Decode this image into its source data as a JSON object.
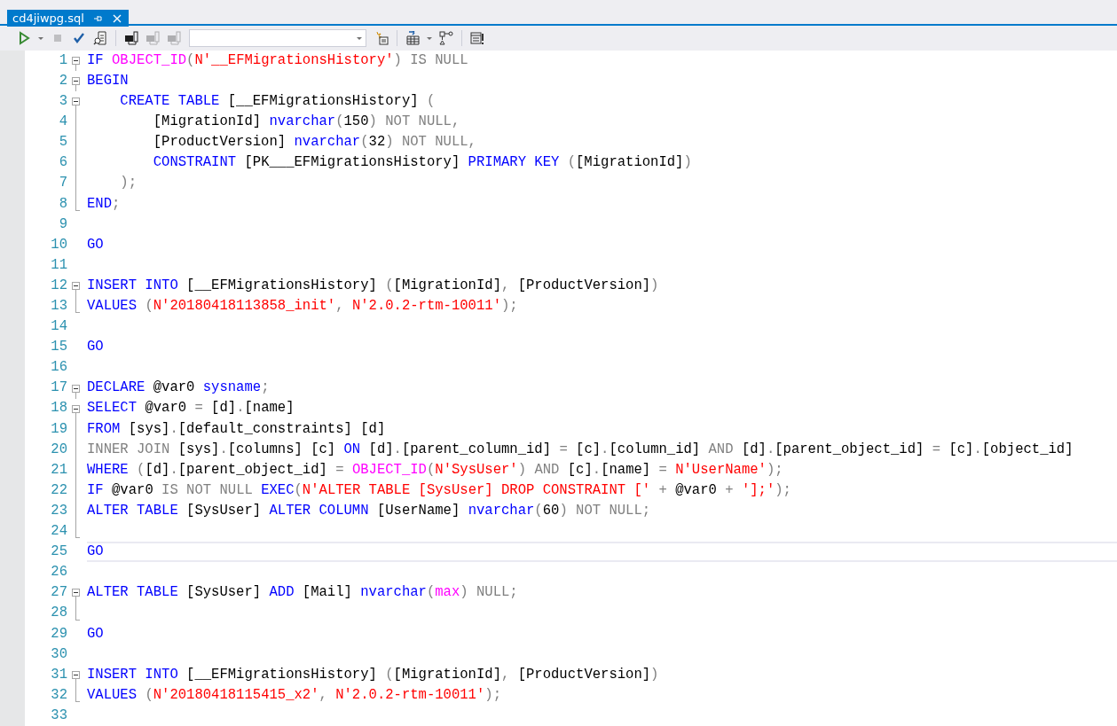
{
  "tab": {
    "title": "cd4jiwpg.sql",
    "selected": true
  },
  "toolbar": [
    {
      "kind": "run",
      "disabled": false
    },
    {
      "kind": "caret",
      "disabled": false
    },
    {
      "kind": "stop",
      "disabled": true
    },
    {
      "kind": "check",
      "disabled": false
    },
    {
      "kind": "doc-search",
      "disabled": false
    },
    {
      "kind": "separator"
    },
    {
      "kind": "connect",
      "disabled": false
    },
    {
      "kind": "connection",
      "disabled": true
    },
    {
      "kind": "connection",
      "disabled": true
    },
    {
      "kind": "combo",
      "disabled": false
    },
    {
      "kind": "new-window",
      "disabled": false
    },
    {
      "kind": "separator"
    },
    {
      "kind": "grid",
      "disabled": false
    },
    {
      "kind": "caret",
      "disabled": false
    },
    {
      "kind": "diagram",
      "disabled": false
    },
    {
      "kind": "separator"
    },
    {
      "kind": "results",
      "disabled": false
    }
  ],
  "editor": {
    "lines": [
      {
        "number": "1",
        "kind": "fold-start",
        "expanded": true,
        "tokens": [
          {
            "kind": "kw",
            "text": "IF "
          },
          {
            "kind": "fn",
            "text": "OBJECT_ID"
          },
          {
            "kind": "op",
            "text": "("
          },
          {
            "kind": "str",
            "text": "N'__EFMigrationsHistory'"
          },
          {
            "kind": "op",
            "text": ") IS NULL"
          }
        ]
      },
      {
        "number": "2",
        "kind": "fold-start",
        "expanded": true,
        "tokens": [
          {
            "kind": "kw",
            "text": "BEGIN"
          }
        ]
      },
      {
        "number": "3",
        "kind": "fold-start",
        "expanded": true,
        "tokens": [
          {
            "kind": "kw",
            "text": "    CREATE TABLE "
          },
          {
            "kind": "id",
            "text": "[__EFMigrationsHistory] "
          },
          {
            "kind": "op",
            "text": "("
          }
        ]
      },
      {
        "number": "4",
        "kind": "fold-body",
        "tokens": [
          {
            "kind": "id",
            "text": "        [MigrationId] "
          },
          {
            "kind": "kw",
            "text": "nvarchar"
          },
          {
            "kind": "op",
            "text": "("
          },
          {
            "kind": "id",
            "text": "150"
          },
          {
            "kind": "op",
            "text": ") NOT NULL,"
          }
        ]
      },
      {
        "number": "5",
        "kind": "fold-body",
        "tokens": [
          {
            "kind": "id",
            "text": "        [ProductVersion] "
          },
          {
            "kind": "kw",
            "text": "nvarchar"
          },
          {
            "kind": "op",
            "text": "("
          },
          {
            "kind": "id",
            "text": "32"
          },
          {
            "kind": "op",
            "text": ") NOT NULL,"
          }
        ]
      },
      {
        "number": "6",
        "kind": "fold-body",
        "tokens": [
          {
            "kind": "kw",
            "text": "        CONSTRAINT "
          },
          {
            "kind": "id",
            "text": "[PK___EFMigrationsHistory] "
          },
          {
            "kind": "kw",
            "text": "PRIMARY KEY "
          },
          {
            "kind": "op",
            "text": "("
          },
          {
            "kind": "id",
            "text": "[MigrationId]"
          },
          {
            "kind": "op",
            "text": ")"
          }
        ]
      },
      {
        "number": "7",
        "kind": "fold-body",
        "tokens": [
          {
            "kind": "op",
            "text": "    );"
          }
        ]
      },
      {
        "number": "8",
        "kind": "fold-end",
        "tokens": [
          {
            "kind": "kw",
            "text": "END"
          },
          {
            "kind": "op",
            "text": ";"
          }
        ]
      },
      {
        "number": "9"
      },
      {
        "number": "10",
        "tokens": [
          {
            "kind": "kw",
            "text": "GO"
          }
        ]
      },
      {
        "number": "11"
      },
      {
        "number": "12",
        "kind": "fold-start",
        "expanded": true,
        "tokens": [
          {
            "kind": "kw",
            "text": "INSERT INTO "
          },
          {
            "kind": "id",
            "text": "[__EFMigrationsHistory] "
          },
          {
            "kind": "op",
            "text": "("
          },
          {
            "kind": "id",
            "text": "[MigrationId]"
          },
          {
            "kind": "op",
            "text": ", "
          },
          {
            "kind": "id",
            "text": "[ProductVersion]"
          },
          {
            "kind": "op",
            "text": ")"
          }
        ]
      },
      {
        "number": "13",
        "kind": "fold-end",
        "tokens": [
          {
            "kind": "kw",
            "text": "VALUES "
          },
          {
            "kind": "op",
            "text": "("
          },
          {
            "kind": "str",
            "text": "N'20180418113858_init'"
          },
          {
            "kind": "op",
            "text": ", "
          },
          {
            "kind": "str",
            "text": "N'2.0.2-rtm-10011'"
          },
          {
            "kind": "op",
            "text": ");"
          }
        ]
      },
      {
        "number": "14"
      },
      {
        "number": "15",
        "tokens": [
          {
            "kind": "kw",
            "text": "GO"
          }
        ]
      },
      {
        "number": "16"
      },
      {
        "number": "17",
        "kind": "fold-start",
        "expanded": true,
        "tokens": [
          {
            "kind": "kw",
            "text": "DECLARE "
          },
          {
            "kind": "id",
            "text": "@var0 "
          },
          {
            "kind": "kw",
            "text": "sysname"
          },
          {
            "kind": "op",
            "text": ";"
          }
        ]
      },
      {
        "number": "18",
        "kind": "fold-start",
        "expanded": true,
        "tokens": [
          {
            "kind": "kw",
            "text": "SELECT "
          },
          {
            "kind": "id",
            "text": "@var0 "
          },
          {
            "kind": "op",
            "text": "= "
          },
          {
            "kind": "id",
            "text": "[d]"
          },
          {
            "kind": "op",
            "text": "."
          },
          {
            "kind": "id",
            "text": "[name]"
          }
        ]
      },
      {
        "number": "19",
        "kind": "fold-body",
        "tokens": [
          {
            "kind": "kw",
            "text": "FROM "
          },
          {
            "kind": "id",
            "text": "[sys]"
          },
          {
            "kind": "op",
            "text": "."
          },
          {
            "kind": "id",
            "text": "[default_constraints] [d]"
          }
        ]
      },
      {
        "number": "20",
        "kind": "fold-body",
        "tokens": [
          {
            "kind": "op",
            "text": "INNER JOIN "
          },
          {
            "kind": "id",
            "text": "[sys]"
          },
          {
            "kind": "op",
            "text": "."
          },
          {
            "kind": "id",
            "text": "[columns] [c] "
          },
          {
            "kind": "kw",
            "text": "ON "
          },
          {
            "kind": "id",
            "text": "[d]"
          },
          {
            "kind": "op",
            "text": "."
          },
          {
            "kind": "id",
            "text": "[parent_column_id] "
          },
          {
            "kind": "op",
            "text": "= "
          },
          {
            "kind": "id",
            "text": "[c]"
          },
          {
            "kind": "op",
            "text": "."
          },
          {
            "kind": "id",
            "text": "[column_id] "
          },
          {
            "kind": "op",
            "text": "AND "
          },
          {
            "kind": "id",
            "text": "[d]"
          },
          {
            "kind": "op",
            "text": "."
          },
          {
            "kind": "id",
            "text": "[parent_object_id] "
          },
          {
            "kind": "op",
            "text": "= "
          },
          {
            "kind": "id",
            "text": "[c]"
          },
          {
            "kind": "op",
            "text": "."
          },
          {
            "kind": "id",
            "text": "[object_id]"
          }
        ]
      },
      {
        "number": "21",
        "kind": "fold-body",
        "tokens": [
          {
            "kind": "kw",
            "text": "WHERE "
          },
          {
            "kind": "op",
            "text": "("
          },
          {
            "kind": "id",
            "text": "[d]"
          },
          {
            "kind": "op",
            "text": "."
          },
          {
            "kind": "id",
            "text": "[parent_object_id] "
          },
          {
            "kind": "op",
            "text": "= "
          },
          {
            "kind": "fn",
            "text": "OBJECT_ID"
          },
          {
            "kind": "op",
            "text": "("
          },
          {
            "kind": "str",
            "text": "N'SysUser'"
          },
          {
            "kind": "op",
            "text": ") AND "
          },
          {
            "kind": "id",
            "text": "[c]"
          },
          {
            "kind": "op",
            "text": "."
          },
          {
            "kind": "id",
            "text": "[name] "
          },
          {
            "kind": "op",
            "text": "= "
          },
          {
            "kind": "str",
            "text": "N'UserName'"
          },
          {
            "kind": "op",
            "text": ");"
          }
        ]
      },
      {
        "number": "22",
        "kind": "fold-body",
        "tokens": [
          {
            "kind": "kw",
            "text": "IF "
          },
          {
            "kind": "id",
            "text": "@var0 "
          },
          {
            "kind": "op",
            "text": "IS NOT NULL "
          },
          {
            "kind": "kw",
            "text": "EXEC"
          },
          {
            "kind": "op",
            "text": "("
          },
          {
            "kind": "str",
            "text": "N'ALTER TABLE [SysUser] DROP CONSTRAINT ['"
          },
          {
            "kind": "op",
            "text": " + "
          },
          {
            "kind": "id",
            "text": "@var0"
          },
          {
            "kind": "op",
            "text": " + "
          },
          {
            "kind": "str",
            "text": "'];'"
          },
          {
            "kind": "op",
            "text": ");"
          }
        ]
      },
      {
        "number": "23",
        "kind": "fold-body",
        "tokens": [
          {
            "kind": "kw",
            "text": "ALTER TABLE "
          },
          {
            "kind": "id",
            "text": "[SysUser] "
          },
          {
            "kind": "kw",
            "text": "ALTER COLUMN "
          },
          {
            "kind": "id",
            "text": "[UserName] "
          },
          {
            "kind": "kw",
            "text": "nvarchar"
          },
          {
            "kind": "op",
            "text": "("
          },
          {
            "kind": "id",
            "text": "60"
          },
          {
            "kind": "op",
            "text": ") NOT NULL;"
          }
        ]
      },
      {
        "number": "24",
        "kind": "fold-end"
      },
      {
        "number": "25",
        "current": true,
        "tokens": [
          {
            "kind": "kw",
            "text": "GO"
          }
        ]
      },
      {
        "number": "26"
      },
      {
        "number": "27",
        "kind": "fold-start",
        "expanded": true,
        "tokens": [
          {
            "kind": "kw",
            "text": "ALTER TABLE "
          },
          {
            "kind": "id",
            "text": "[SysUser] "
          },
          {
            "kind": "kw",
            "text": "ADD "
          },
          {
            "kind": "id",
            "text": "[Mail] "
          },
          {
            "kind": "kw",
            "text": "nvarchar"
          },
          {
            "kind": "op",
            "text": "("
          },
          {
            "kind": "fn",
            "text": "max"
          },
          {
            "kind": "op",
            "text": ") NULL;"
          }
        ]
      },
      {
        "number": "28",
        "kind": "fold-end"
      },
      {
        "number": "29",
        "tokens": [
          {
            "kind": "kw",
            "text": "GO"
          }
        ]
      },
      {
        "number": "30"
      },
      {
        "number": "31",
        "kind": "fold-start",
        "expanded": true,
        "tokens": [
          {
            "kind": "kw",
            "text": "INSERT INTO "
          },
          {
            "kind": "id",
            "text": "[__EFMigrationsHistory] "
          },
          {
            "kind": "op",
            "text": "("
          },
          {
            "kind": "id",
            "text": "[MigrationId]"
          },
          {
            "kind": "op",
            "text": ", "
          },
          {
            "kind": "id",
            "text": "[ProductVersion]"
          },
          {
            "kind": "op",
            "text": ")"
          }
        ]
      },
      {
        "number": "32",
        "kind": "fold-end",
        "tokens": [
          {
            "kind": "kw",
            "text": "VALUES "
          },
          {
            "kind": "op",
            "text": "("
          },
          {
            "kind": "str",
            "text": "N'20180418115415_x2'"
          },
          {
            "kind": "op",
            "text": ", "
          },
          {
            "kind": "str",
            "text": "N'2.0.2-rtm-10011'"
          },
          {
            "kind": "op",
            "text": ");"
          }
        ]
      },
      {
        "number": "33"
      }
    ]
  }
}
